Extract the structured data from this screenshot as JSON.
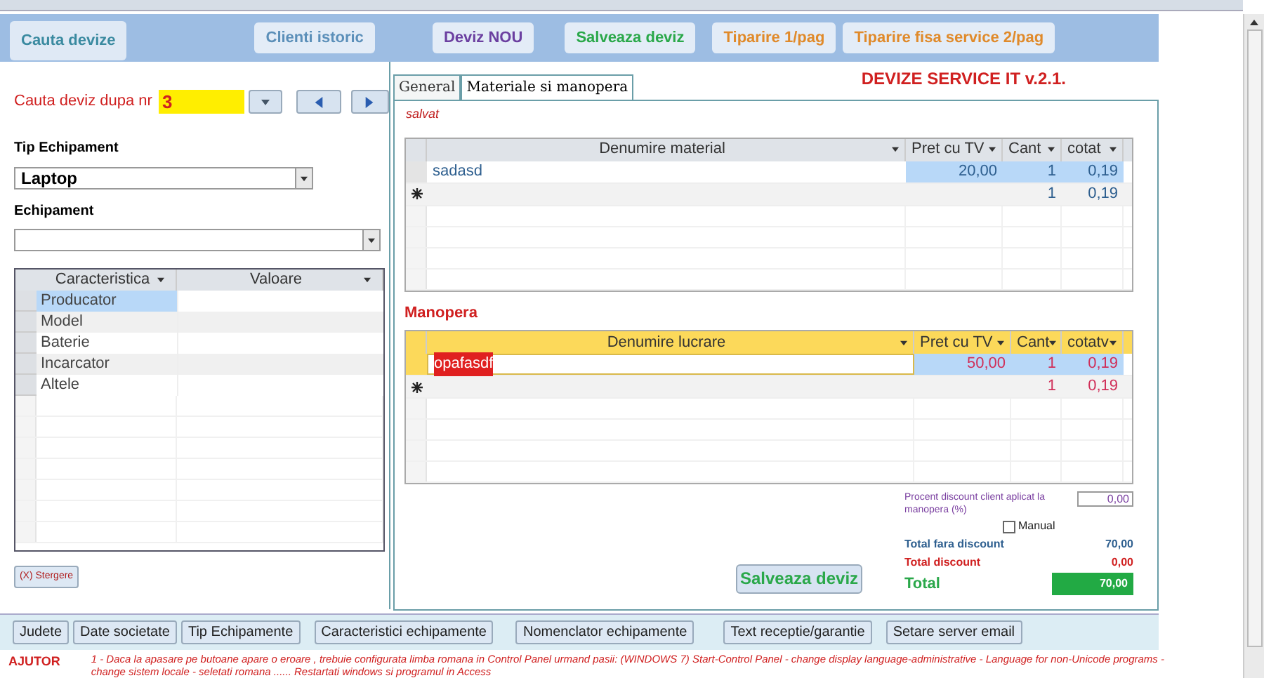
{
  "toolbar": {
    "buttons": [
      {
        "label": "Cauta devize",
        "color": "#3a8aa0",
        "selected": true
      },
      {
        "label": "Clienti istoric",
        "color": "#5b8fb9",
        "selected": false
      },
      {
        "label": "Deviz NOU",
        "color": "#6b3fa0",
        "selected": false
      },
      {
        "label": "Salveaza deviz",
        "color": "#2aa84a",
        "selected": false
      },
      {
        "label": "Tiparire 1/pag",
        "color": "#e08a2a",
        "selected": false
      },
      {
        "label": "Tiparire fisa service 2/pag",
        "color": "#e08a2a",
        "selected": false
      }
    ]
  },
  "search": {
    "label": "Cauta deviz dupa nr",
    "value": "3"
  },
  "tip_echipament": {
    "label": "Tip Echipament",
    "value": "Laptop"
  },
  "echipament": {
    "label": "Echipament"
  },
  "caracteristici": {
    "columns": [
      "Caracteristica",
      "Valoare"
    ],
    "rows": [
      {
        "name": "Producator",
        "selected": true
      },
      {
        "name": "Model",
        "selected": false
      },
      {
        "name": "Baterie",
        "selected": false
      },
      {
        "name": "Incarcator",
        "selected": false
      },
      {
        "name": "Altele",
        "selected": false
      }
    ]
  },
  "delete_button": "(X) Stergere",
  "app_title": "DEVIZE SERVICE IT v.2.1.",
  "tabs": [
    {
      "label": "General",
      "selected": false
    },
    {
      "label": "Materiale si manopera",
      "selected": true
    }
  ],
  "status": "salvat",
  "materiale": {
    "columns": [
      "Denumire material",
      "Pret cu TV",
      "Cant",
      "cotat"
    ],
    "rows": [
      {
        "values": [
          "sadasd",
          "20,00",
          "1",
          "0,19"
        ]
      }
    ],
    "new_row": {
      "cant": "1",
      "cotat": "0,19"
    }
  },
  "manopera": {
    "title": "Manopera",
    "columns": [
      "Denumire lucrare",
      "Pret cu TV",
      "Cant",
      "cotatv"
    ],
    "rows": [
      {
        "values": [
          "opafasdf",
          "50,00",
          "1",
          "0,19"
        ]
      }
    ],
    "new_row": {
      "cant": "1",
      "cotat": "0,19"
    }
  },
  "discount": {
    "label": "Procent discount client aplicat la manopera (%)",
    "value": "0,00",
    "manual": {
      "label": "Manual",
      "checked": false
    }
  },
  "totals": [
    {
      "kind": "plain",
      "label": "Total fara discount",
      "value": "70,00"
    },
    {
      "kind": "discount",
      "label": "Total discount",
      "value": "0,00"
    },
    {
      "kind": "total",
      "label": "Total",
      "value": "70,00"
    }
  ],
  "save_button": "Salveaza deviz",
  "bottom_buttons": [
    "Judete",
    "Date societate",
    "Tip Echipamente",
    "Caracteristici echipamente",
    "Nomenclator echipamente",
    "Text receptie/garantie",
    "Setare server email"
  ],
  "help": {
    "label": "AJUTOR",
    "text": "1 - Daca la apasare pe butoane apare o eroare , trebuie configurata limba romana in Control Panel urmand pasii: (WINDOWS 7) Start-Control Panel - change display language-administrative - Language for non-Unicode programs -change sistem locale - seletati romana ...... Restartati windows si programul in Access"
  }
}
